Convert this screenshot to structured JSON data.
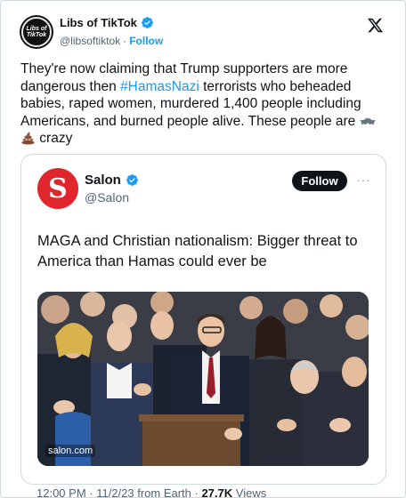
{
  "author": {
    "display_name": "Libs of TikTok",
    "handle": "@libsoftiktok",
    "separator": "·",
    "follow_label": "Follow",
    "avatar_text_line1": "Libs of",
    "avatar_text_line2": "TikTok"
  },
  "tweet": {
    "text_part1": "They're now claiming that Trump supporters are more dangerous then ",
    "hashtag": "#HamasNazi",
    "text_part2": " terrorists who beheaded babies, raped women, murdered 1,400 people including Americans, and burned people alive. These people are ",
    "text_part3": " crazy"
  },
  "quoted": {
    "display_name": "Salon",
    "handle": "@Salon",
    "logo_letter": "S",
    "follow_label": "Follow",
    "more_label": "···",
    "text": "MAGA and Christian nationalism: Bigger threat to America than Hamas could ever be",
    "image_caption": "salon.com"
  },
  "meta": {
    "time_date": "12:00 PM · 11/2/23 from Earth · ",
    "views_count": "27.7K",
    "views_label": " Views"
  },
  "colors": {
    "accent": "#1d9bf0",
    "salon_red": "#e0262d",
    "verified_blue": "#1d9bf0"
  },
  "icons": [
    "verified-badge-icon",
    "x-logo-icon",
    "bat-emoji-icon",
    "poo-emoji-icon",
    "more-icon"
  ]
}
